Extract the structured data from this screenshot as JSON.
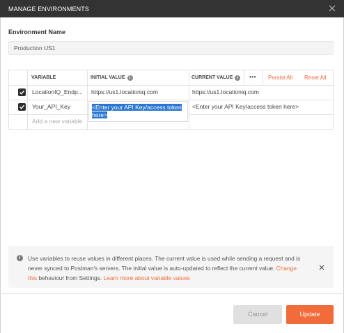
{
  "window": {
    "title": "MANAGE ENVIRONMENTS",
    "close_icon": "close-icon"
  },
  "environment": {
    "name_label": "Environment Name",
    "name_value": "Production US1"
  },
  "table": {
    "headers": {
      "variable": "VARIABLE",
      "initial_value": "INITIAL VALUE",
      "current_value": "CURRENT VALUE",
      "more": "•••",
      "persist_all": "Persist All",
      "reset_all": "Reset All"
    },
    "rows": [
      {
        "checked": true,
        "variable": "LocationIQ_Endp...",
        "initial_value": "https://us1.locationiq.com",
        "current_value": "https://us1.locationiq.com"
      },
      {
        "checked": true,
        "variable": "Your_API_Key",
        "initial_value": "<Enter your API Key/access token here>",
        "current_value": "<Enter your API Key/access token here>"
      }
    ],
    "new_variable_placeholder": "Add a new variable"
  },
  "notice": {
    "text_main": "Use variables to reuse values in different places. The current value is used while sending a request and is never synced to Postman's servers. The initial value is auto-updated to reflect the current value.",
    "link_change": "Change this",
    "text_after": "behaviour from Settings.",
    "link_learn": "Learn more about variable values"
  },
  "buttons": {
    "cancel": "Cancel",
    "update": "Update"
  },
  "colors": {
    "accent": "#f26b3a",
    "titlebar": "#333333",
    "selection": "#2a76d2"
  }
}
